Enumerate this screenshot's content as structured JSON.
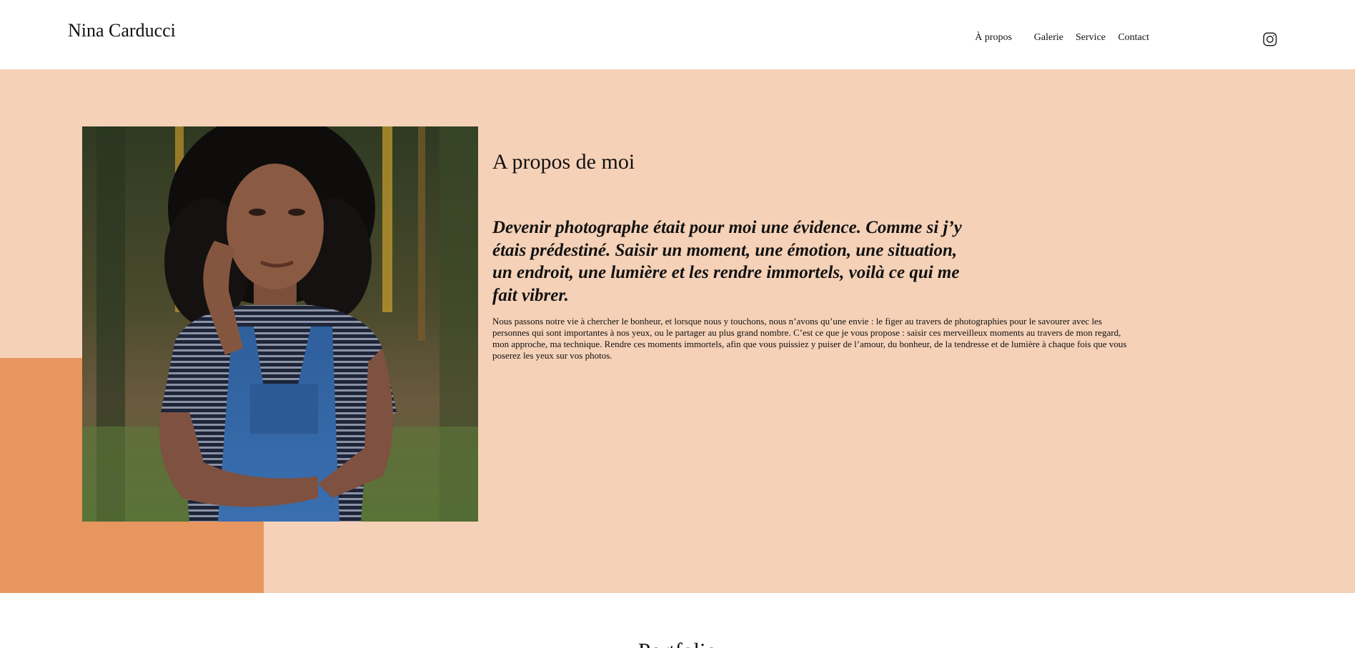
{
  "header": {
    "brand": "Nina Carducci",
    "nav": {
      "about": "À propos",
      "gallery": "Galerie",
      "service": "Service",
      "contact": "Contact"
    },
    "instagram_icon": "instagram-icon"
  },
  "about": {
    "photo_alt": "Nina Carducci",
    "title": "A propos de moi",
    "quote": "Devenir photographe était pour moi une évidence. Comme si j’y étais prédestiné. Saisir un moment, une émotion, une situation, un endroit, une lumière et les rendre immortels, voilà ce qui me fait vibrer.",
    "text": "Nous passons notre vie à chercher le bonheur, et lorsque nous y touchons, nous n’avons qu’une envie : le figer au travers de photographies pour le savourer avec les personnes qui sont importantes à nos yeux, ou le partager au plus grand nombre. C’est ce que je vous propose : saisir ces merveilleux moments au travers de mon regard, mon approche, ma technique. Rendre ces moments immortels, afin que vous puissiez y puiser de l’amour, du bonheur, de la tendresse et de lumière à chaque fois que vous poserez les yeux sur vos photos."
  },
  "portfolio": {
    "title": "Portfolio"
  },
  "colors": {
    "about_background": "#f5d1b7",
    "accent": "#e6965e",
    "header_background": "#ffffff",
    "text": "#111111"
  }
}
